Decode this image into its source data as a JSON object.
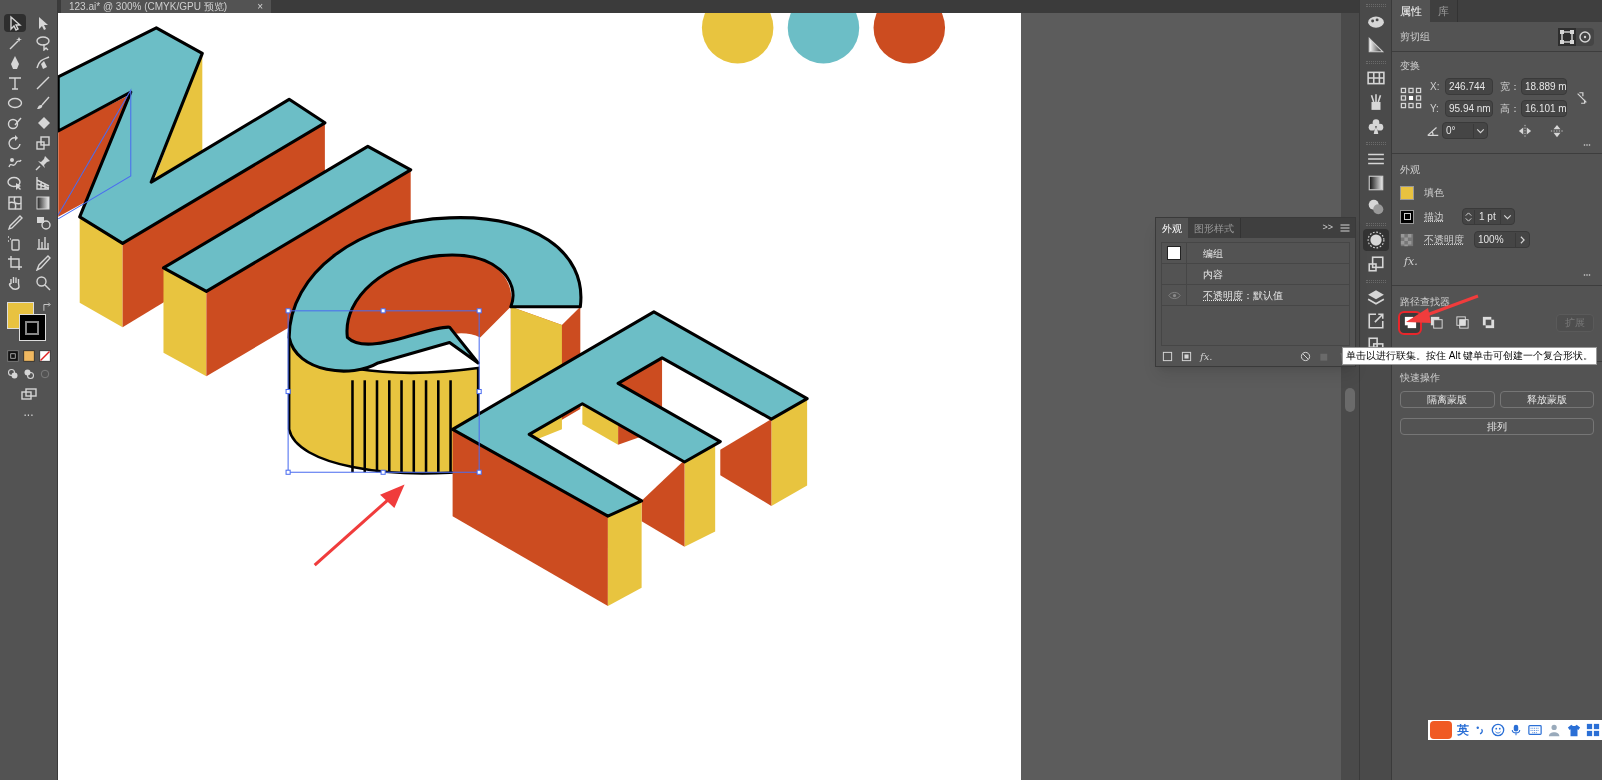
{
  "document_tab": {
    "title": "123.ai* @ 300% (CMYK/GPU 预览)",
    "close": "×"
  },
  "toolbar": {
    "tools": [
      {
        "selected": true
      },
      {
        "selected": false
      },
      {
        "selected": false
      },
      {
        "selected": false
      },
      {
        "selected": false
      },
      {
        "selected": false
      },
      {
        "selected": false
      },
      {
        "selected": false
      },
      {
        "selected": false
      },
      {
        "selected": false
      },
      {
        "selected": false
      },
      {
        "selected": false
      },
      {
        "selected": false
      },
      {
        "selected": false
      },
      {
        "selected": false
      },
      {
        "selected": false
      },
      {
        "selected": false
      },
      {
        "selected": false
      },
      {
        "selected": false
      },
      {
        "selected": false
      },
      {
        "selected": false
      },
      {
        "selected": false
      },
      {
        "selected": false
      },
      {
        "selected": false
      },
      {
        "selected": false
      },
      {
        "selected": false
      },
      {
        "selected": false
      },
      {
        "selected": false
      }
    ],
    "more": "..."
  },
  "panel_dock": {
    "icons": [
      {
        "selected": false
      },
      {
        "selected": false
      },
      {
        "selected": false
      },
      {
        "selected": false
      },
      {
        "selected": false
      },
      {
        "selected": false
      },
      {
        "selected": false
      },
      {
        "selected": false
      },
      {
        "selected": true
      },
      {
        "selected": false
      },
      {
        "selected": false
      },
      {
        "selected": false
      },
      {
        "selected": false
      }
    ]
  },
  "appearance_panel": {
    "tabs": [
      {
        "label": "外观",
        "selected": true
      },
      {
        "label": "图形样式",
        "selected": false
      }
    ],
    "more": ">>",
    "rows": [
      {
        "kind": "swatch",
        "label": "编组"
      },
      {
        "kind": "plain",
        "label": "内容"
      },
      {
        "kind": "eye",
        "label": "不透明度",
        "value": "：默认值"
      }
    ],
    "effects": "fx."
  },
  "properties_panel": {
    "tabs": [
      {
        "label": "属性",
        "selected": true
      },
      {
        "label": "库",
        "selected": false
      }
    ],
    "object_type": "剪切组",
    "transform": {
      "title": "变换",
      "x_label": "X:",
      "x_value": "246.744",
      "y_label": "Y:",
      "y_value": "95.94 nm",
      "w_label": "宽：",
      "w_value": "18.889 m",
      "h_label": "高：",
      "h_value": "16.101 m",
      "angle_value": "0°"
    },
    "appearance": {
      "title": "外观",
      "fill_label": "填色",
      "stroke_label": "描边",
      "stroke_weight": "1 pt",
      "opacity_label": "不透明度",
      "opacity_value": "100%",
      "effects": "fx."
    },
    "pathfinder": {
      "title": "路径查找器",
      "shape_modes": [
        {
          "selected": true
        },
        {
          "selected": false
        },
        {
          "selected": false
        },
        {
          "selected": false
        }
      ],
      "expand": "扩展"
    },
    "quick_actions": {
      "title": "快速操作",
      "buttons": [
        "隔离蒙版",
        "释放蒙版",
        "排列"
      ]
    }
  },
  "tooltip": "单击以进行联集。按住 Alt 键单击可创建一个复合形状。",
  "ime_bar": {
    "mode": "英"
  }
}
